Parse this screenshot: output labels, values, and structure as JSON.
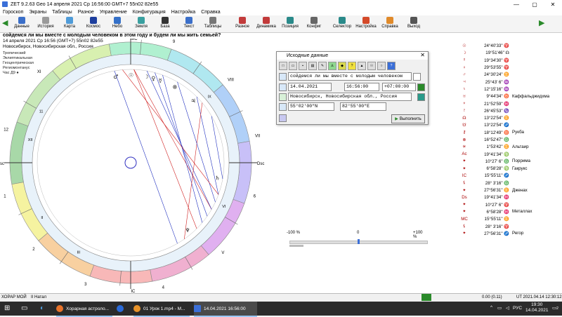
{
  "window": {
    "title": "ZET 9.2.63 Geo    14 апреля 2021  Ср  16:56:00 GMT+7 55n02  82e55"
  },
  "menu": [
    "Гороскоп",
    "Экраны",
    "Таблицы",
    "Разное",
    "Управление",
    "Конфигурация",
    "Настройка",
    "Справка"
  ],
  "toolbar": [
    {
      "label": "Данные",
      "icon": "data-icon",
      "color": "#3b6fc9"
    },
    {
      "label": "История",
      "icon": "history-icon",
      "color": "#9a9a9a"
    },
    {
      "label": "Карта",
      "icon": "map-icon",
      "color": "#4f9bd8"
    },
    {
      "label": "Космос",
      "icon": "cosmos-icon",
      "color": "#1e3f9e"
    },
    {
      "label": "Небо",
      "icon": "sky-icon",
      "color": "#3470c8"
    },
    {
      "label": "Земля",
      "icon": "earth-icon",
      "color": "#3aa0a0"
    },
    {
      "label": "База",
      "icon": "database-icon",
      "color": "#333333"
    },
    {
      "label": "Текст",
      "icon": "text-icon",
      "color": "#3b6fc9"
    },
    {
      "label": "Таблицы",
      "icon": "tables-icon",
      "color": "#777777"
    },
    {
      "label": "Разное",
      "icon": "misc-icon",
      "color": "#c23b3b"
    },
    {
      "label": "Динамика",
      "icon": "dynamics-icon",
      "color": "#c23b3b"
    },
    {
      "label": "Позиция",
      "icon": "position-icon",
      "color": "#2a8a8a"
    },
    {
      "label": "Конфиг",
      "icon": "config-icon",
      "color": "#666666"
    },
    {
      "label": "Селектор",
      "icon": "selector-icon",
      "color": "#2a8a8a"
    },
    {
      "label": "Настройка",
      "icon": "settings-icon",
      "color": "#d44a2a"
    },
    {
      "label": "Справка",
      "icon": "help-icon",
      "color": "#e08a2a"
    },
    {
      "label": "Выход",
      "icon": "exit-icon",
      "color": "#555555"
    }
  ],
  "question": "сойдемся ли мы вместе с молодым человеком в этом году и будем ли мы жить семьей?",
  "info_lines": [
    "14 апреля 2021   Ср  16:56 (GMT+7) 55n02  82e55",
    "Новосибирск, Новосибирская обл., Россия"
  ],
  "system_lines": [
    "Тропический",
    "Эклиптикальная",
    "Геоцентрическая",
    "Региомонтанус",
    "Час Д9"
  ],
  "axes": {
    "mc": "MC",
    "ic": "IC",
    "asc": "Asc",
    "dsc": "Dsc"
  },
  "houses": [
    "1",
    "2",
    "3",
    "4",
    "V",
    "6",
    "VII",
    "VIII",
    "9",
    "X",
    "XI",
    "12"
  ],
  "house_alt": [
    "II",
    "III",
    "IX",
    "11",
    "XII",
    "VI"
  ],
  "planets": [
    {
      "glyph": "☉",
      "value": "24°40'33\" ♈",
      "name": ""
    },
    {
      "glyph": "☽",
      "value": "19°51'46\" ☊",
      "name": ""
    },
    {
      "glyph": "☿",
      "value": "19°34'30\" ♈",
      "name": ""
    },
    {
      "glyph": "♀",
      "value": "29°53'55\" ♈",
      "name": ""
    },
    {
      "glyph": "♂",
      "value": "24°30'24\" ♊",
      "name": ""
    },
    {
      "glyph": "♃",
      "value": "25°43' 6\" ♒",
      "name": ""
    },
    {
      "glyph": "♄",
      "value": "12°15'16\" ♒",
      "name": ""
    },
    {
      "glyph": "♅",
      "value": "9°44'34\" ♉",
      "name": "Каффальджидхма"
    },
    {
      "glyph": "♆",
      "value": "21°52'59\" ♓",
      "name": ""
    },
    {
      "glyph": "♇",
      "value": "26°45'53\" ♑",
      "name": ""
    },
    {
      "glyph": "☊",
      "value": "13°22'54\" ♊",
      "name": ""
    },
    {
      "glyph": "☋",
      "value": "13°22'54\" ♐",
      "name": ""
    },
    {
      "glyph": "⚷",
      "value": "18°12'49\" ♉",
      "name": "Рукба"
    },
    {
      "glyph": "⊗",
      "value": "16°52'47\" ♎",
      "name": ""
    },
    {
      "glyph": "✳",
      "value": "1°53'42\" ♊",
      "name": "Альтаир"
    },
    {
      "glyph": "Ac",
      "value": "19°41'34\" ♍",
      "name": ""
    },
    {
      "glyph": "✦",
      "value": "10°27' 6\" ♎",
      "name": "Поррима"
    },
    {
      "glyph": "✦",
      "value": "6°58'28\" ♍",
      "name": "Гакрукс"
    },
    {
      "glyph": "IC",
      "value": "15°55'11\" ♐",
      "name": ""
    },
    {
      "glyph": "⚸",
      "value": "28° 3'16\" ♎",
      "name": ""
    },
    {
      "glyph": "✦",
      "value": "27°56'31\" ♊",
      "name": "Дженах"
    },
    {
      "glyph": "Ds",
      "value": "19°41'34\" ♓",
      "name": ""
    },
    {
      "glyph": "✦",
      "value": "10°27' 6\" ♈",
      "name": ""
    },
    {
      "glyph": "✦",
      "value": "6°58'28\" ♓",
      "name": "Металлах"
    },
    {
      "glyph": "MC",
      "value": "15°55'11\" ♊",
      "name": ""
    },
    {
      "glyph": "⚸",
      "value": "28° 3'16\" ♈",
      "name": ""
    },
    {
      "glyph": "✦",
      "value": "27°56'31\" ♐",
      "name": "Регор"
    }
  ],
  "dialog": {
    "title": "Исходные данные",
    "question": "сойдемся ли мы вместе с молодым человеком",
    "date": "14.04.2021",
    "time": "16:56:00",
    "tz": "+07:00:00",
    "place": "Новосибирск, Новосибирская обл., Россия",
    "lat": "55°02'00\"N",
    "lon": "82°55'00\"E",
    "exec": "Выполнить"
  },
  "slider": {
    "min": "-100 %",
    "mid": "0",
    "max": "+100 %",
    "value_pct": 0
  },
  "status": {
    "left": "ХОРАР МОЙ",
    "mode": "II Натал",
    "num": "0.00 (0.11)",
    "ut": "UT  2021.04.14 12:30:12"
  },
  "taskbar": {
    "tasks": [
      "Хорарная астроло...",
      "",
      "01 Урок 1.mp4 - М...",
      "14.04.2021  16:56:00"
    ],
    "lang": "РУС",
    "time": "19:30",
    "date": "14.04.2021",
    "notif": "2"
  },
  "zodiac_colors": [
    "#a8d8a8",
    "#f5f3a0",
    "#f8d0a0",
    "#f8b8b8",
    "#f0b0d0",
    "#e0b0f0",
    "#c8c0f8",
    "#b0d0f8",
    "#b0e8f0",
    "#b0f0d0",
    "#d8f0b0",
    "#c8e8b8"
  ]
}
